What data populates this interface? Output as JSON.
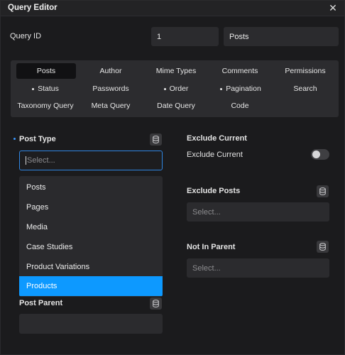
{
  "window": {
    "title": "Query Editor"
  },
  "query_id": {
    "label": "Query ID",
    "value": "1",
    "name": "Posts"
  },
  "tabs": [
    {
      "label": "Posts",
      "bullet": false
    },
    {
      "label": "Author",
      "bullet": false
    },
    {
      "label": "Mime Types",
      "bullet": false
    },
    {
      "label": "Comments",
      "bullet": false
    },
    {
      "label": "Permissions",
      "bullet": false
    },
    {
      "label": "Status",
      "bullet": true
    },
    {
      "label": "Passwords",
      "bullet": false
    },
    {
      "label": "Order",
      "bullet": true
    },
    {
      "label": "Pagination",
      "bullet": true
    },
    {
      "label": "Search",
      "bullet": false
    },
    {
      "label": "Taxonomy Query",
      "bullet": false
    },
    {
      "label": "Meta Query",
      "bullet": false
    },
    {
      "label": "Date Query",
      "bullet": false
    },
    {
      "label": "Code",
      "bullet": false
    }
  ],
  "post_type": {
    "label": "Post Type",
    "placeholder": "Select...",
    "options": [
      "Posts",
      "Pages",
      "Media",
      "Case Studies",
      "Product Variations",
      "Products"
    ],
    "selected": "Products"
  },
  "post_parent": {
    "label": "Post Parent",
    "value": ""
  },
  "exclude_current": {
    "heading": "Exclude Current",
    "toggle_label": "Exclude Current",
    "enabled": false
  },
  "exclude_posts": {
    "label": "Exclude Posts",
    "placeholder": "Select..."
  },
  "not_in_parent": {
    "label": "Not In Parent",
    "placeholder": "Select..."
  },
  "icons": {
    "close": "close-icon",
    "database": "database-icon"
  },
  "colors": {
    "accent": "#0d99ff",
    "focus_border": "#2f86e3",
    "background": "#1b1b1d"
  }
}
